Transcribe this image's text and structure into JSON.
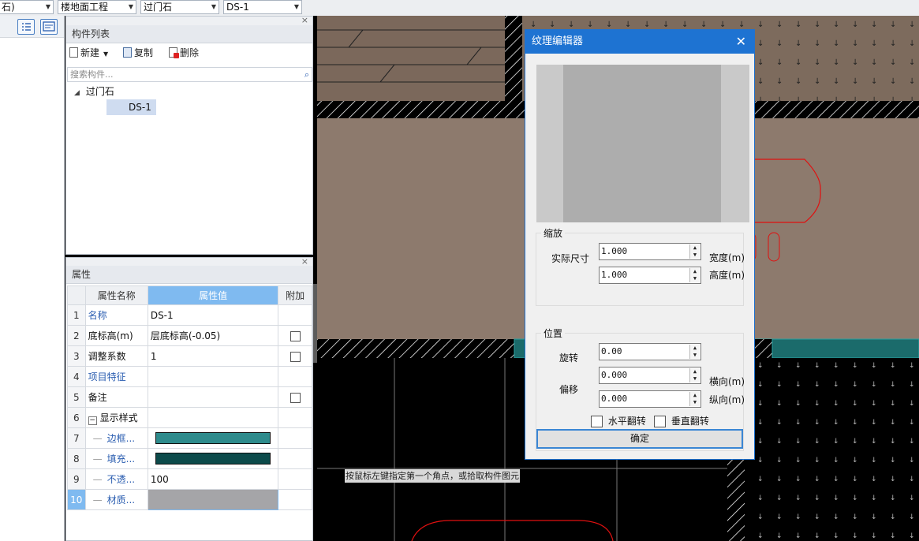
{
  "toolbar": {
    "combos": [
      {
        "value": "石)"
      },
      {
        "value": "楼地面工程"
      },
      {
        "value": "过门石"
      },
      {
        "value": "DS-1"
      }
    ]
  },
  "component_list": {
    "title": "构件列表",
    "new_label": "新建",
    "copy_label": "复制",
    "delete_label": "删除",
    "search_placeholder": "搜索构件...",
    "tree": {
      "parent": "过门石",
      "child": "DS-1"
    }
  },
  "properties": {
    "title": "属性",
    "headers": {
      "name": "属性名称",
      "value": "属性值",
      "extra": "附加"
    },
    "rows": [
      {
        "num": "1",
        "name": "名称",
        "value": "DS-1"
      },
      {
        "num": "2",
        "name": "底标高(m)",
        "value": "层底标高(-0.05)"
      },
      {
        "num": "3",
        "name": "调整系数",
        "value": "1"
      },
      {
        "num": "4",
        "name": "项目特征",
        "value": ""
      },
      {
        "num": "5",
        "name": "备注",
        "value": ""
      },
      {
        "num": "6",
        "name": "显示样式",
        "value": ""
      },
      {
        "num": "7",
        "name": "边框...",
        "value": ""
      },
      {
        "num": "8",
        "name": "填充...",
        "value": ""
      },
      {
        "num": "9",
        "name": "不透...",
        "value": "100"
      },
      {
        "num": "10",
        "name": "材质...",
        "value": ""
      }
    ],
    "colors": {
      "border": "#2e8b8c",
      "fill": "#0c4a4a",
      "material": "#a5a5a8"
    }
  },
  "canvas": {
    "status_hint": "按鼠标左键指定第一个角点，或拾取构件图元"
  },
  "dialog": {
    "title": "纹理编辑器",
    "scale_group": "缩放",
    "actual_size_label": "实际尺寸",
    "width_value": "1.000",
    "width_unit": "宽度(m)",
    "height_value": "1.000",
    "height_unit": "高度(m)",
    "position_group": "位置",
    "rotate_label": "旋转",
    "rotate_value": "0.00",
    "offset_label": "偏移",
    "offset_x_value": "0.000",
    "offset_x_unit": "横向(m)",
    "offset_y_value": "0.000",
    "offset_y_unit": "纵向(m)",
    "flip_h_label": "水平翻转",
    "flip_v_label": "垂直翻转",
    "ok_label": "确定"
  }
}
